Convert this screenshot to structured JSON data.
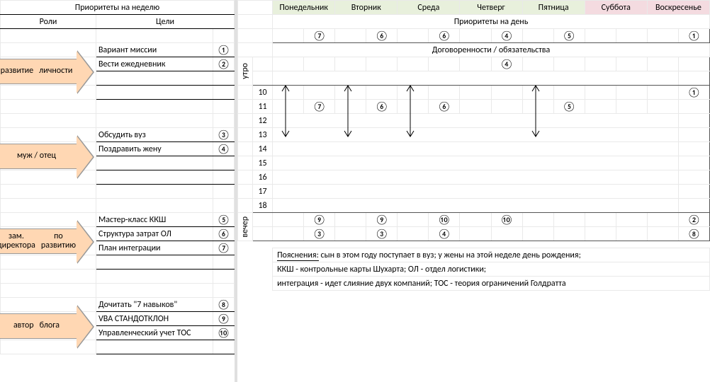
{
  "left": {
    "title": "Приоритеты на неделю",
    "col_roles": "Роли",
    "col_goals": "Цели",
    "roles": [
      {
        "name_l1": "развитие",
        "name_l2": "личности",
        "goals": [
          {
            "text": "Вариант миссии",
            "num": "①"
          },
          {
            "text": "Вести ежедневник",
            "num": "②"
          }
        ]
      },
      {
        "name_l1": "муж / отец",
        "name_l2": "",
        "goals": [
          {
            "text": "Обсудить вуз",
            "num": "③"
          },
          {
            "text": "Поздравить жену",
            "num": "④"
          }
        ]
      },
      {
        "name_l1": "зам. директора",
        "name_l2": "по развитию",
        "goals": [
          {
            "text": "Мастер-класс ККШ",
            "num": "⑤"
          },
          {
            "text": "Структура затрат ОЛ",
            "num": "⑥"
          },
          {
            "text": "План интеграции",
            "num": "⑦"
          }
        ]
      },
      {
        "name_l1": "автор",
        "name_l2": "блога",
        "goals": [
          {
            "text": "Дочитать \"7 навыков\"",
            "num": "⑧"
          },
          {
            "text": "VBA СТАНДОТКЛОН",
            "num": "⑨"
          },
          {
            "text": "Управленческий учет ТОС",
            "num": "⑩"
          }
        ]
      }
    ]
  },
  "right": {
    "days": [
      "Понедельник",
      "Вторник",
      "Среда",
      "Четверг",
      "Пятница",
      "Суббота",
      "Воскресенье"
    ],
    "day_prio_title": "Приоритеты на день",
    "day_prio": [
      "⑦",
      "⑥",
      "⑥",
      "④",
      "⑤",
      "",
      "①"
    ],
    "commit_title": "Договоренности / обязательства",
    "morning_label": "утро",
    "evening_label": "вечер",
    "morning_row": [
      "",
      "",
      "",
      "④",
      "",
      "",
      ""
    ],
    "hours": [
      "10",
      "11",
      "12",
      "13",
      "14",
      "15",
      "16",
      "17",
      "18"
    ],
    "row10": [
      "",
      "",
      "",
      "",
      "",
      "",
      "①"
    ],
    "row11": [
      "⑦",
      "⑥",
      "⑥",
      "",
      "⑤",
      "",
      ""
    ],
    "eve1": [
      "⑨",
      "⑨",
      "⑩",
      "⑩",
      "",
      "",
      "②"
    ],
    "eve2": [
      "③",
      "③",
      "④",
      "",
      "",
      "",
      "⑧"
    ],
    "notes_label": "Пояснения:",
    "notes1": " сын в этом году поступает в вуз; у жены на этой неделе день рождения;",
    "notes2": "ККШ - контрольные карты Шухарта; ОЛ - отдел логистики;",
    "notes3": "интеграция - идет слияние двух компаний; ТОС - теория ограничений Голдратта"
  }
}
